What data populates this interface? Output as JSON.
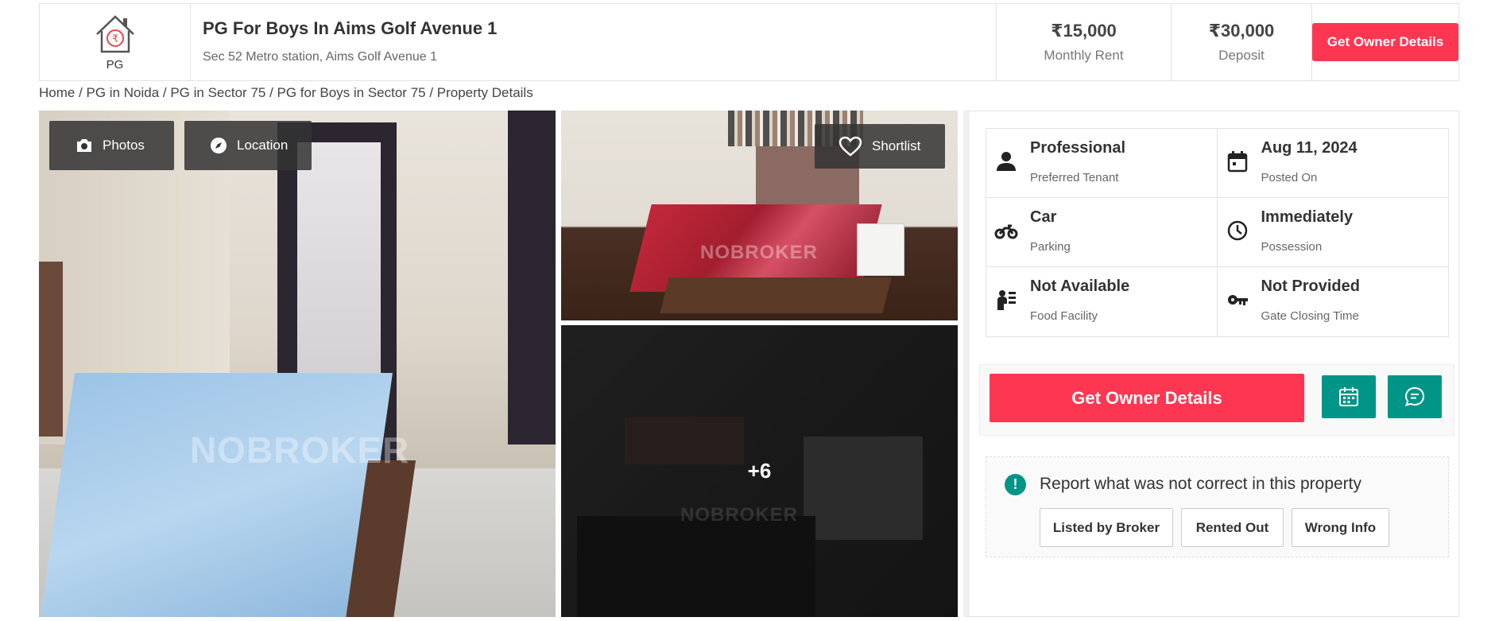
{
  "header": {
    "logo_label": "PG",
    "title": "PG For Boys In Aims Golf Avenue 1",
    "subtitle": "Sec 52 Metro station, Aims Golf Avenue 1",
    "rent": {
      "value": "₹15,000",
      "label": "Monthly Rent"
    },
    "deposit": {
      "value": "₹30,000",
      "label": "Deposit"
    },
    "cta_label": "Get Owner Details",
    "accent_color": "#fd3752"
  },
  "breadcrumb": "Home / PG in Noida / PG in Sector 75 / PG for Boys in Sector 75 / Property Details",
  "gallery": {
    "photos_label": "Photos",
    "location_label": "Location",
    "shortlist_label": "Shortlist",
    "more_count": "+6",
    "watermark": "NOBROKER"
  },
  "details": [
    {
      "value": "Professional",
      "label": "Preferred Tenant",
      "icon": "person-icon"
    },
    {
      "value": "Aug 11, 2024",
      "label": "Posted On",
      "icon": "calendar-icon"
    },
    {
      "value": "Car",
      "label": "Parking",
      "icon": "motorbike-icon"
    },
    {
      "value": "Immediately",
      "label": "Possession",
      "icon": "clock-icon"
    },
    {
      "value": "Not Available",
      "label": "Food Facility",
      "icon": "food-icon"
    },
    {
      "value": "Not Provided",
      "label": "Gate Closing Time",
      "icon": "key-icon"
    }
  ],
  "cta": {
    "label": "Get Owner Details",
    "secondary_color": "#009587"
  },
  "report": {
    "text": "Report what was not correct in this property",
    "options": [
      "Listed by Broker",
      "Rented Out",
      "Wrong Info"
    ]
  }
}
